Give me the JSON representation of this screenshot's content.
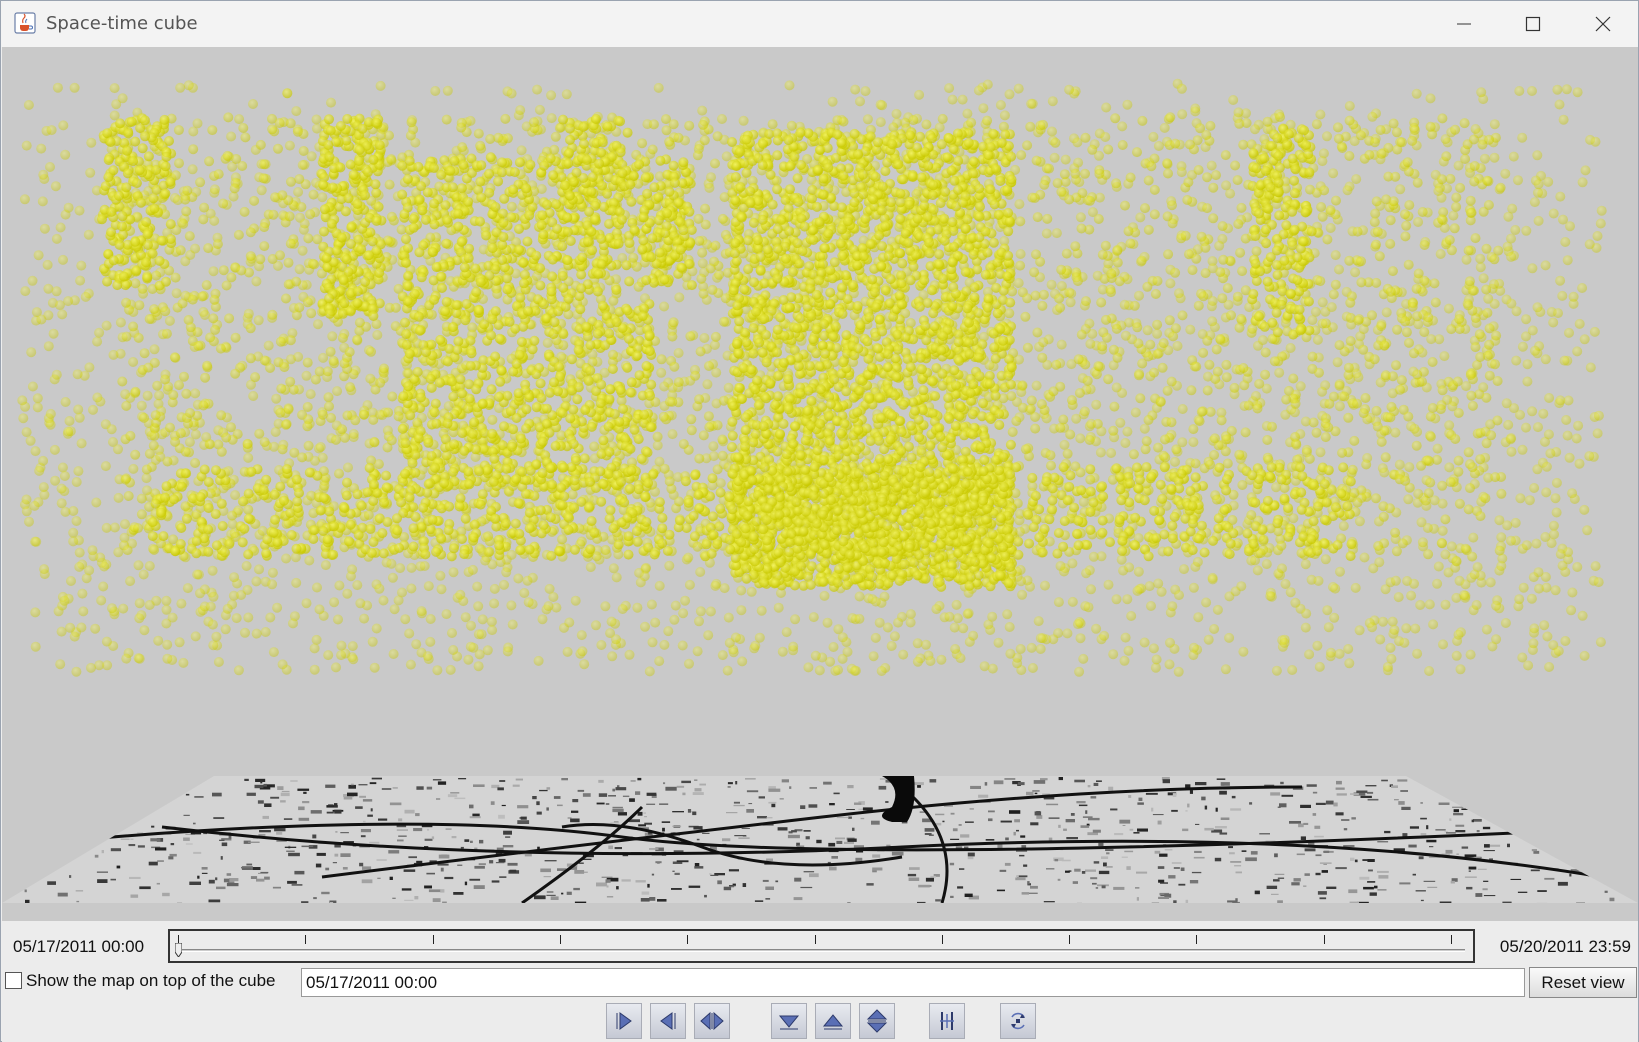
{
  "window": {
    "title": "Space-time cube",
    "app_icon": "java-cup-icon"
  },
  "time": {
    "start": "05/17/2011 00:00",
    "end": "05/20/2011 23:59",
    "current": "05/17/2011 00:00",
    "position": 0.0
  },
  "options": {
    "show_map_label": "Show the map on top of the cube",
    "show_map_checked": false,
    "reset_label": "Reset view"
  },
  "controls": [
    {
      "name": "play-forward-button",
      "icon": "play-forward-icon"
    },
    {
      "name": "play-backward-button",
      "icon": "play-backward-icon"
    },
    {
      "name": "play-both-button",
      "icon": "play-both-icon"
    },
    {
      "name": "move-down-button",
      "icon": "triangle-down-icon"
    },
    {
      "name": "move-up-button",
      "icon": "triangle-up-icon"
    },
    {
      "name": "move-up-down-button",
      "icon": "up-down-icon"
    },
    {
      "name": "interval-button",
      "icon": "interval-bars-icon"
    },
    {
      "name": "rotate-button",
      "icon": "rotate-icon"
    }
  ],
  "colors": {
    "points": "#e6e600",
    "background": "#c9c9c9"
  }
}
